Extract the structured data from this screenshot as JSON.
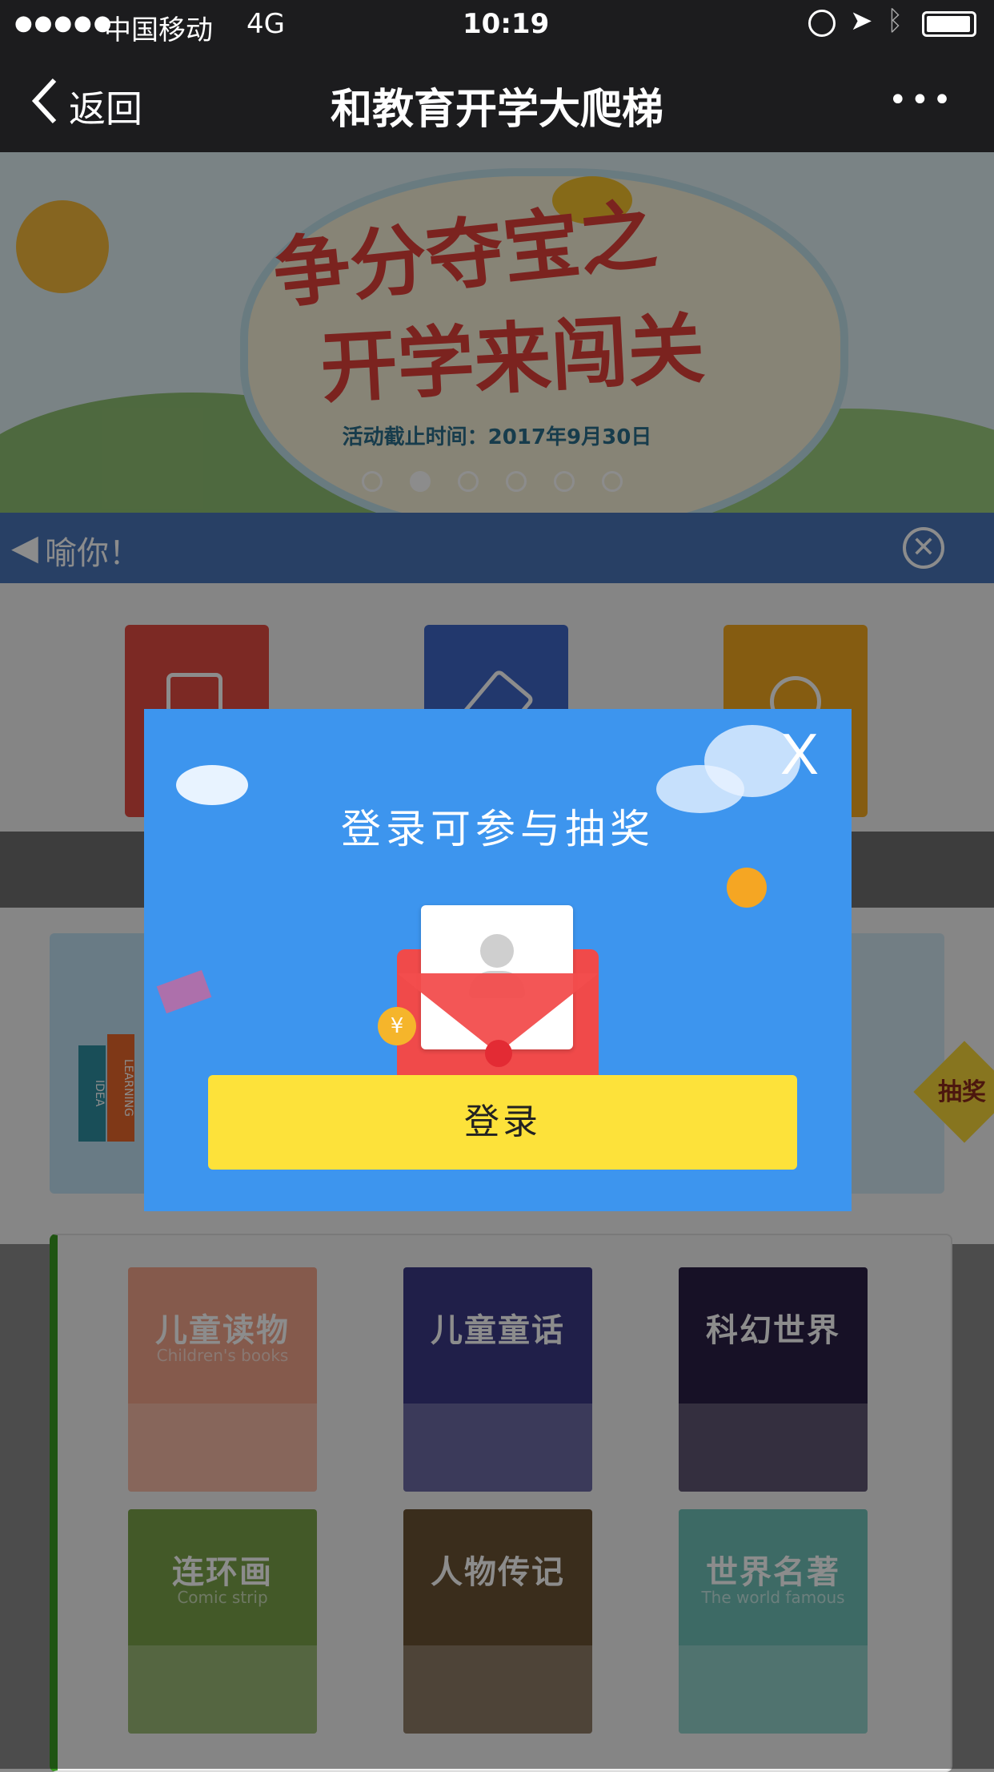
{
  "status_bar": {
    "carrier": "中国移动",
    "network": "4G",
    "time": "10:19"
  },
  "nav": {
    "back_label": "返回",
    "title": "和教育开学大爬梯",
    "more_label": "•••"
  },
  "banner": {
    "headline_line1": "争分夺宝之",
    "headline_line2": "开学来闯关",
    "deadline": "活动截止时间：2017年9月30日",
    "carousel_total": 6,
    "carousel_active_index": 1
  },
  "notice": {
    "text": "喻你！"
  },
  "modal": {
    "title": "登录可参与抽奖",
    "close_label": "X",
    "login_label": "登录"
  },
  "side_badge": {
    "label": "抽奖"
  },
  "books": [
    {
      "title": "儿童读物",
      "subtitle": "Children's books",
      "color": "#f3a58a"
    },
    {
      "title": "儿童童话",
      "subtitle": "",
      "color": "#3b3a86"
    },
    {
      "title": "科幻世界",
      "subtitle": "",
      "color": "#2a1f45"
    },
    {
      "title": "连环画",
      "subtitle": "Comic strip",
      "color": "#7aa34a"
    },
    {
      "title": "人物传记",
      "subtitle": "",
      "color": "#6a5233"
    },
    {
      "title": "世界名著",
      "subtitle": "The world famous",
      "color": "#6fc2b8"
    }
  ],
  "book_spines": {
    "left": "IDEA",
    "right": "LEARNING"
  },
  "colors": {
    "nav_bg": "#1c1c1e",
    "modal_bg": "#3d95ee",
    "login_button": "#fde23a",
    "accent_green": "#3a9a22"
  }
}
